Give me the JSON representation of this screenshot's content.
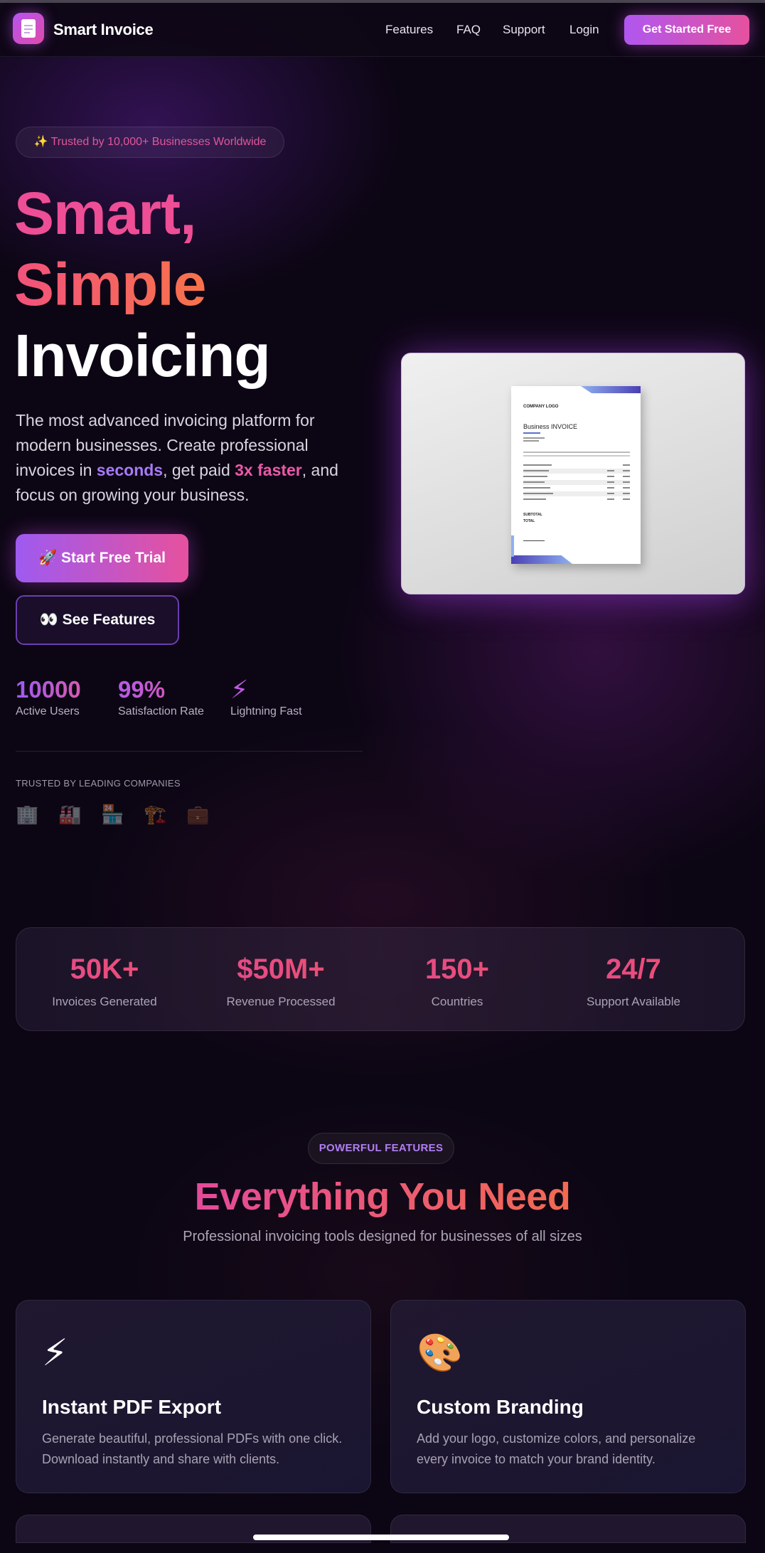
{
  "nav": {
    "brand": "Smart Invoice",
    "links": [
      "Features",
      "FAQ",
      "Support",
      "Login"
    ],
    "cta": "Get Started Free"
  },
  "hero": {
    "badge": "✨ Trusted by 10,000+ Businesses Worldwide",
    "title_line1": "Smart,",
    "title_line2": "Simple",
    "title_line3": "Invoicing",
    "desc_part1": "The most advanced invoicing platform for modern businesses. Create professional invoices in ",
    "desc_hl1": "seconds",
    "desc_part2": ", get paid ",
    "desc_hl2": "3x faster",
    "desc_part3": ", and focus on growing your business.",
    "primary_button": "🚀 Start Free Trial",
    "secondary_button": "👀 See Features",
    "stats": [
      {
        "value": "10000",
        "label": "Active Users"
      },
      {
        "value": "99%",
        "label": "Satisfaction Rate"
      },
      {
        "value": "⚡",
        "label": "Lightning Fast"
      }
    ],
    "trusted_label": "TRUSTED BY LEADING COMPANIES",
    "companies": [
      "🏢",
      "🏭",
      "🏪",
      "🏗️",
      "💼"
    ]
  },
  "invoice_preview": {
    "logo_text": "COMPANY LOGO",
    "title": "Business INVOICE",
    "subtotal_label": "SUBTOTAL",
    "total_label": "TOTAL"
  },
  "stats": [
    {
      "value": "50K+",
      "label": "Invoices Generated"
    },
    {
      "value": "$50M+",
      "label": "Revenue Processed"
    },
    {
      "value": "150+",
      "label": "Countries"
    },
    {
      "value": "24/7",
      "label": "Support Available"
    }
  ],
  "features": {
    "badge": "POWERFUL FEATURES",
    "title": "Everything You Need",
    "subtitle": "Professional invoicing tools designed for businesses of all sizes",
    "cards": [
      {
        "icon": "⚡",
        "icon_name": "lightning-icon",
        "title": "Instant PDF Export",
        "desc": "Generate beautiful, professional PDFs with one click. Download instantly and share with clients."
      },
      {
        "icon": "🎨",
        "icon_name": "palette-icon",
        "title": "Custom Branding",
        "desc": "Add your logo, customize colors, and personalize every invoice to match your brand identity."
      }
    ]
  }
}
